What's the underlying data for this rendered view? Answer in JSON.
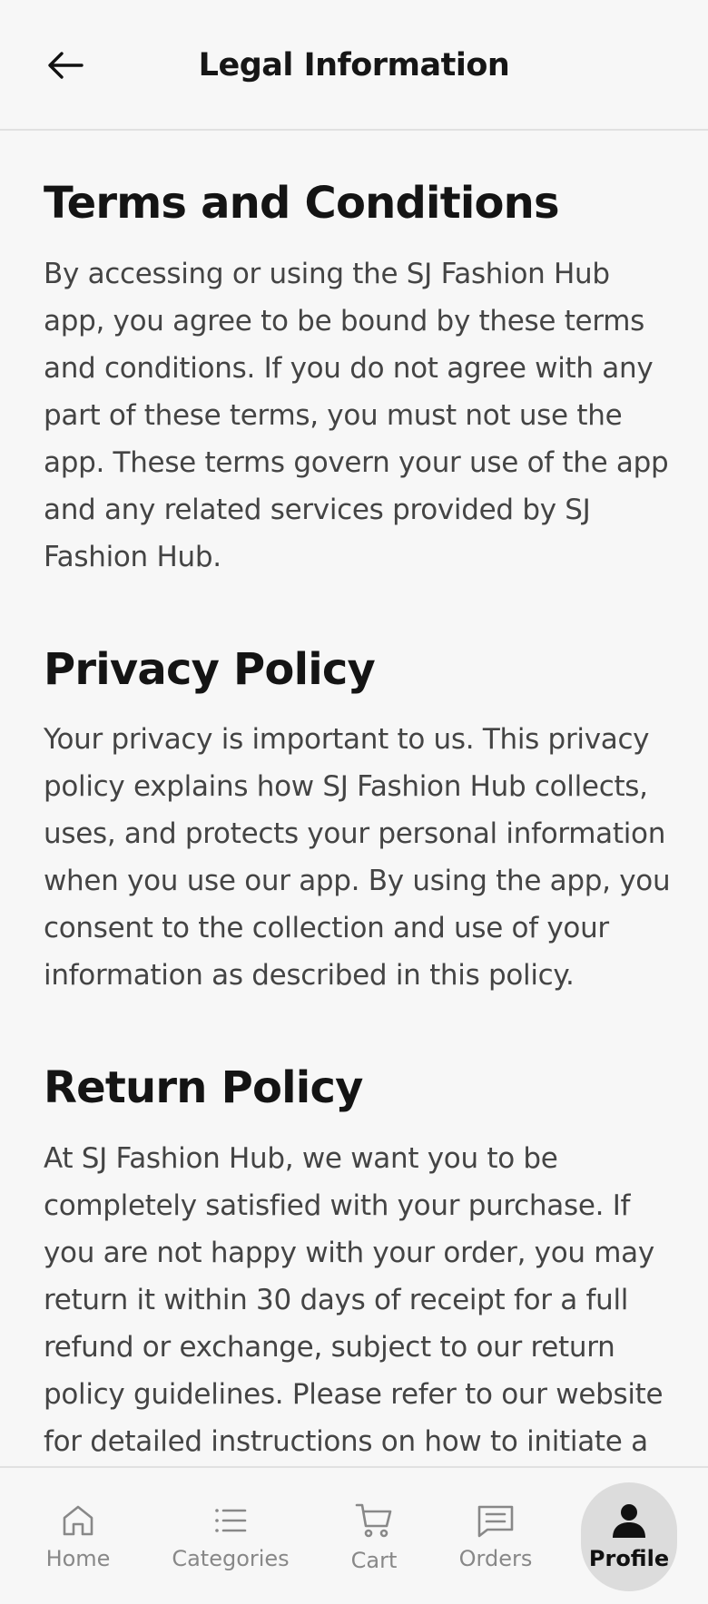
{
  "header": {
    "title": "Legal Information",
    "back_icon": "arrow-left-icon"
  },
  "sections": [
    {
      "title": "Terms and Conditions",
      "body": "By accessing or using the SJ Fashion Hub app, you agree to be bound by these terms and conditions. If you do not agree with any part of these terms, you must not use the app. These terms govern your use of the app and any related services provided by SJ Fashion Hub."
    },
    {
      "title": "Privacy Policy",
      "body": "Your privacy is important to us. This privacy policy explains how SJ Fashion Hub collects, uses, and protects your personal information when you use our app. By using the app, you consent to the collection and use of your information as described in this policy."
    },
    {
      "title": "Return Policy",
      "body": "At SJ Fashion Hub, we want you to be completely satisfied with your purchase. If you are not happy with your order, you may return it within 30 days of receipt for a full refund or exchange, subject to our return policy guidelines. Please refer to our website for detailed instructions on how to initiate a"
    }
  ],
  "tabbar": {
    "items": [
      {
        "label": "Home",
        "icon": "home-icon",
        "active": false
      },
      {
        "label": "Categories",
        "icon": "list-icon",
        "active": false
      },
      {
        "label": "Cart",
        "icon": "cart-icon",
        "active": false
      },
      {
        "label": "Orders",
        "icon": "orders-icon",
        "active": false
      },
      {
        "label": "Profile",
        "icon": "profile-icon",
        "active": true
      }
    ]
  },
  "colors": {
    "background": "#f7f7f7",
    "active_tab": "#dcdcdc",
    "inactive_tab_text": "#888888",
    "body_text": "#444444"
  }
}
